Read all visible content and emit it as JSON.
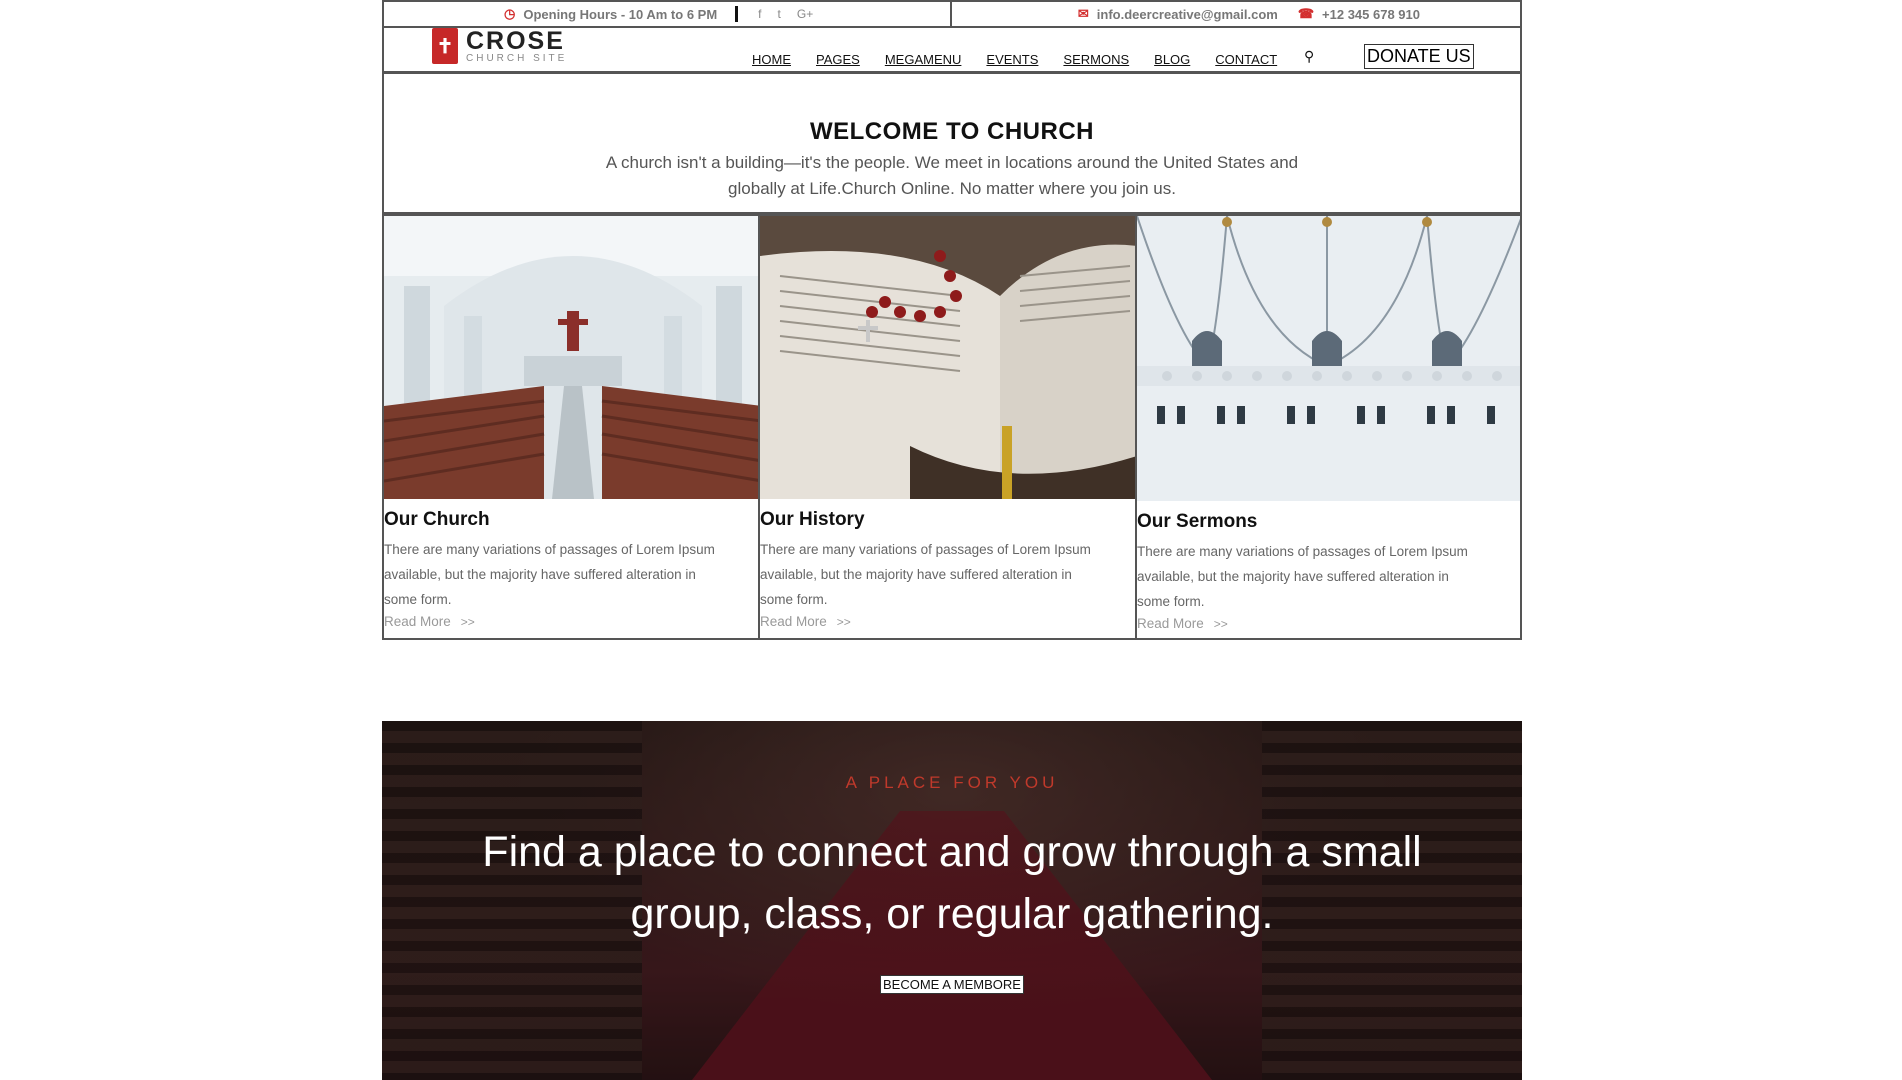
{
  "topbar": {
    "hours": "Opening Hours - 10 Am to 6 PM",
    "email": "info.deercreative@gmail.com",
    "phone": "+12 345 678 910",
    "social": [
      "f",
      "t",
      "G+"
    ]
  },
  "header": {
    "logo_title": "CROSE",
    "logo_subtitle": "CHURCH SITE",
    "nav": [
      "HOME",
      "PAGES",
      "MEGAMENU",
      "EVENTS",
      "SERMONS",
      "BLOG",
      "CONTACT"
    ],
    "donate_label": "DONATE US"
  },
  "welcome": {
    "title": "WELCOME TO CHURCH",
    "text": "A church isn't a building—it's the people. We meet in locations around the United States and globally at Life.Church Online. No matter where you join us."
  },
  "cards": [
    {
      "title": "Our Church",
      "text": "There are many variations of passages of Lorem Ipsum available, but the majority have suffered alteration in some form.",
      "link": "Read More",
      "arrows": ">>"
    },
    {
      "title": "Our History",
      "text": "There are many variations of passages of Lorem Ipsum available, but the majority have suffered alteration in some form.",
      "link": "Read More",
      "arrows": ">>"
    },
    {
      "title": "Our Sermons",
      "text": "There are many variations of passages of Lorem Ipsum available, but the majority have suffered alteration in some form.",
      "link": "Read More",
      "arrows": ">>"
    }
  ],
  "banner": {
    "eyebrow": "A PLACE FOR YOU",
    "heading": "Find a place to connect and grow through a small group, class, or regular gathering.",
    "button": "BECOME A MEMBORE"
  },
  "colors": {
    "accent": "#c62828",
    "text_dark": "#111111",
    "text_muted": "#666666"
  }
}
